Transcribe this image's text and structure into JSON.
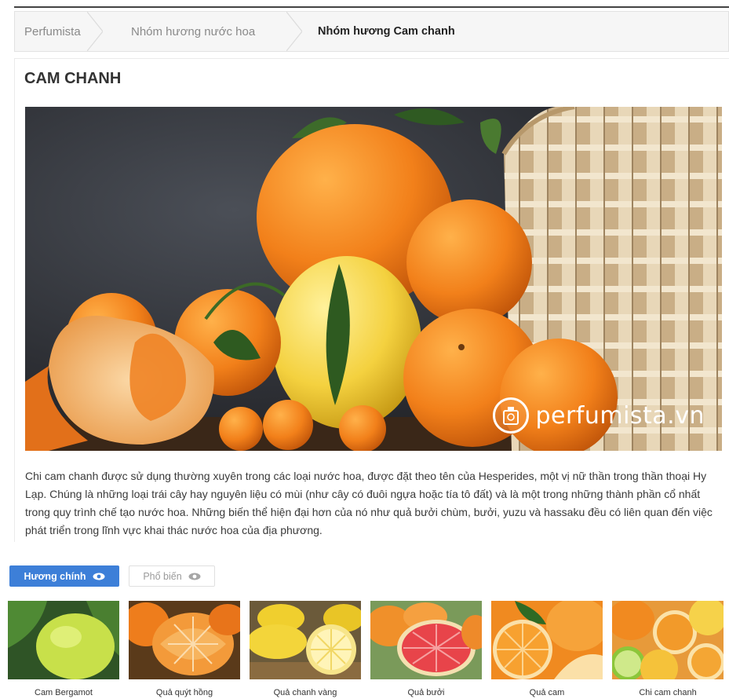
{
  "breadcrumb": {
    "items": [
      {
        "label": "Perfumista"
      },
      {
        "label": "Nhóm hương nước hoa"
      },
      {
        "label": "Nhóm hương Cam chanh"
      }
    ]
  },
  "page": {
    "title": "CAM CHANH",
    "description": "Chi cam chanh được sử dụng thường xuyên trong các loại nước hoa, được đặt theo tên của Hesperides, một vị nữ thần trong thần thoại Hy Lạp. Chúng là những loại trái cây hay nguyên liệu có mùi (như cây có đuôi ngựa hoặc tía tô đất) và là một trong những thành phần cổ nhất trong quy trình chế tạo nước hoa. Những biến thể hiện đại hơn của nó như quả bưởi chùm, bưởi, yuzu và hassaku đều có liên quan đến việc phát triển trong lĩnh vực khai thác nước hoa của địa phương."
  },
  "hero": {
    "watermark_text": "perfumista.vn"
  },
  "tabs": [
    {
      "label": "Hương chính",
      "active": true
    },
    {
      "label": "Phổ biến",
      "active": false
    }
  ],
  "notes": [
    {
      "label": "Cam Bergamot"
    },
    {
      "label": "Quả quýt hồng"
    },
    {
      "label": "Quả chanh vàng"
    },
    {
      "label": "Quả bưởi"
    },
    {
      "label": "Quả cam"
    },
    {
      "label": "Chi cam chanh"
    }
  ],
  "colors": {
    "accent": "#3d7fd8",
    "orange": "#f28a1e",
    "lemon": "#f6d24a"
  }
}
